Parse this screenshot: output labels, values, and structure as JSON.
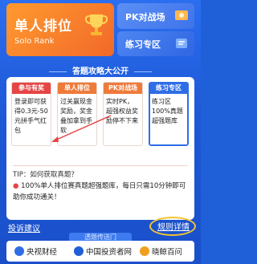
{
  "colors": {
    "background": "#1f5fd8",
    "solo_card": "#f2692a",
    "pk_card": "#3f73ea",
    "practice_card": "#2f66e2",
    "tip_red": "#e64545",
    "tip_orange": "#ef7b3a",
    "tip_blue": "#2f6de6",
    "rules_highlight": "#f4c430"
  },
  "top": {
    "solo_title": "单人排位",
    "solo_subtitle": "Solo Rank",
    "pk_label": "PK对战场",
    "practice_label": "练习专区"
  },
  "strategy": {
    "section_title": "答题攻略大公开",
    "cards": [
      {
        "head": "参与有奖",
        "body": "登录即可获得0.3元-50元拼手气红包",
        "color": "red"
      },
      {
        "head": "单人排位",
        "body": "过关赢现金奖励，奖金叠加拿到手软",
        "color": "orange"
      },
      {
        "head": "PK对战场",
        "body": "实时PK，超强权益奖励停不下来",
        "color": "orange"
      },
      {
        "head": "练习专区",
        "body": "练习区100%真题超强题库",
        "color": "blue"
      }
    ],
    "tip_label": "TIP：如何获取真题？",
    "tip_text": "100%单人排位赛真题超强题库，每日只需10分钟即可助你成功通关！"
  },
  "bottom": {
    "feedback_label": "投诉建议",
    "rules_label": "规则详情",
    "portal_title": "透题传送门",
    "portal_items": [
      {
        "label": "央视财经",
        "icon": "cctv-finance-icon"
      },
      {
        "label": "中国投资者网",
        "icon": "china-investor-icon"
      },
      {
        "label": "晓鲸百问",
        "icon": "xiaojing-icon"
      }
    ]
  }
}
